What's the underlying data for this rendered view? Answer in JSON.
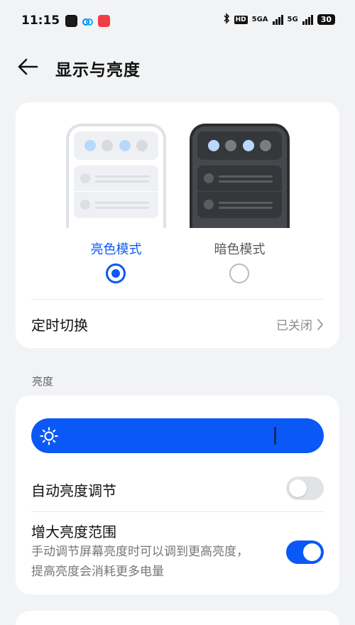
{
  "status_bar": {
    "time": "11:15",
    "hd_label": "HD",
    "network_1": "5GA",
    "network_2": "5G",
    "battery": "30"
  },
  "header": {
    "title": "显示与亮度"
  },
  "display_mode": {
    "light_label": "亮色模式",
    "dark_label": "暗色模式",
    "selected": "light",
    "schedule_label": "定时切换",
    "schedule_value": "已关闭"
  },
  "brightness": {
    "section_label": "亮度",
    "level": 0.83,
    "auto_label": "自动亮度调节",
    "auto_enabled": false,
    "extended_label": "增大亮度范围",
    "extended_desc": "手动调节屏幕亮度时可以调到更高亮度，提高亮度会消耗更多电量",
    "extended_enabled": true
  },
  "colors": {
    "accent": "#0a59f7",
    "background": "#f1f3f5",
    "card": "#ffffff"
  }
}
